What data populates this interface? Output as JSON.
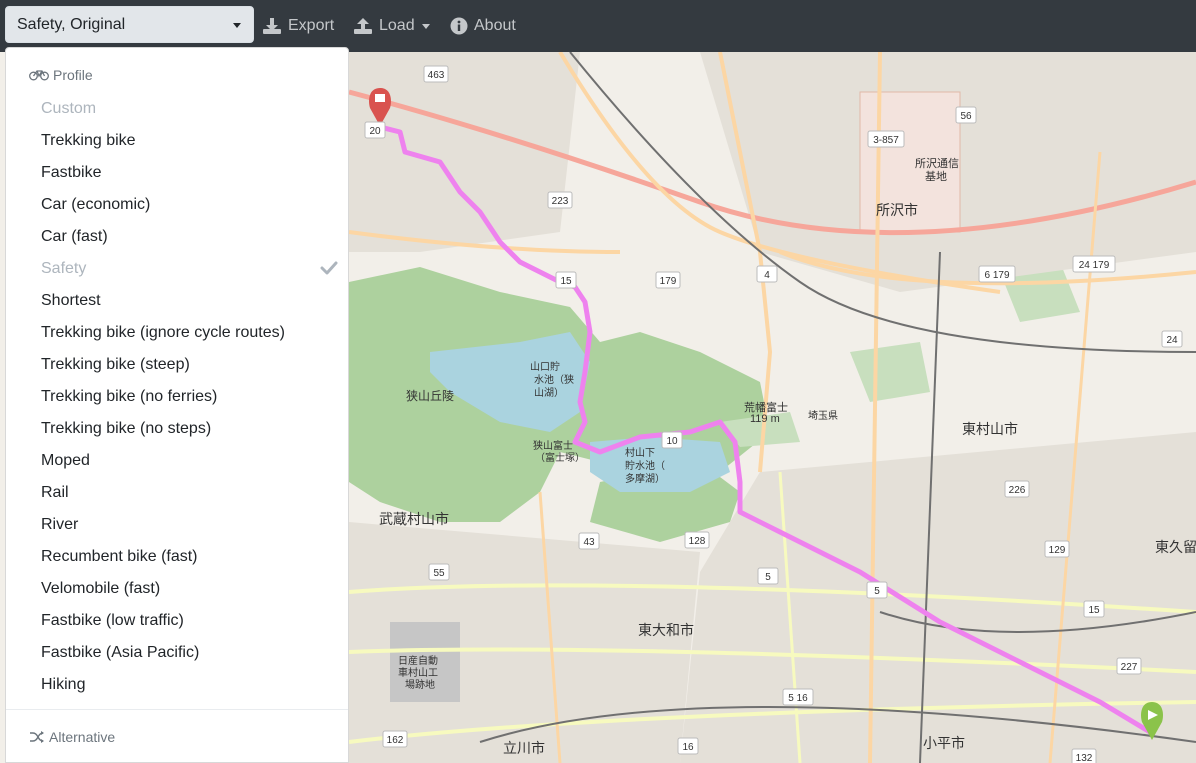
{
  "navbar": {
    "profile_select": "Safety, Original",
    "export_label": "Export",
    "load_label": "Load",
    "about_label": "About"
  },
  "dropdown": {
    "profile_header": "Profile",
    "items": [
      {
        "label": "Custom",
        "disabled": true
      },
      {
        "label": "Trekking bike"
      },
      {
        "label": "Fastbike"
      },
      {
        "label": "Car (economic)"
      },
      {
        "label": "Car (fast)"
      },
      {
        "label": "Safety",
        "disabled": true,
        "selected": true
      },
      {
        "label": "Shortest"
      },
      {
        "label": "Trekking bike (ignore cycle routes)"
      },
      {
        "label": "Trekking bike (steep)"
      },
      {
        "label": "Trekking bike (no ferries)"
      },
      {
        "label": "Trekking bike (no steps)"
      },
      {
        "label": "Moped"
      },
      {
        "label": "Rail"
      },
      {
        "label": "River"
      },
      {
        "label": "Recumbent bike (fast)"
      },
      {
        "label": "Velomobile (fast)"
      },
      {
        "label": "Fastbike (low traffic)"
      },
      {
        "label": "Fastbike (Asia Pacific)"
      },
      {
        "label": "Hiking"
      }
    ],
    "alternative_header": "Alternative"
  },
  "map": {
    "places": {
      "tokorozawa": "所沢市",
      "higashimurayama": "東村山市",
      "musashimurayama": "武蔵村山市",
      "higashiyamato": "東大和市",
      "kodaira": "小平市",
      "tachikawa": "立川市",
      "higashikurume": "東久留",
      "sayama_hills": "狭山丘陵",
      "lake_yamaguchi": "山口貯水池（狭山湖）",
      "lake_murayama": "村山下貯水池（多摩湖）",
      "sayama_fuji": "狭山富士（富士塚）",
      "arahata_fuji": "荒幡富士",
      "arahata_elev": "119 m",
      "komm_base": "所沢通信基地",
      "nissan_site": "日産自動車村山工場跡地",
      "saitama": "埼玉県"
    },
    "road_badges": [
      "463",
      "56",
      "3-857",
      "223",
      "15",
      "179",
      "4",
      "6 179",
      "24 179",
      "24",
      "10",
      "226",
      "43",
      "128",
      "129",
      "5",
      "5",
      "15",
      "227",
      "55",
      "5 16",
      "162",
      "16",
      "132",
      "20"
    ],
    "colors": {
      "route": "#ee82ee",
      "start_marker": "#d9534f",
      "end_marker": "#8bc34a",
      "navbar": "#343a40"
    }
  }
}
